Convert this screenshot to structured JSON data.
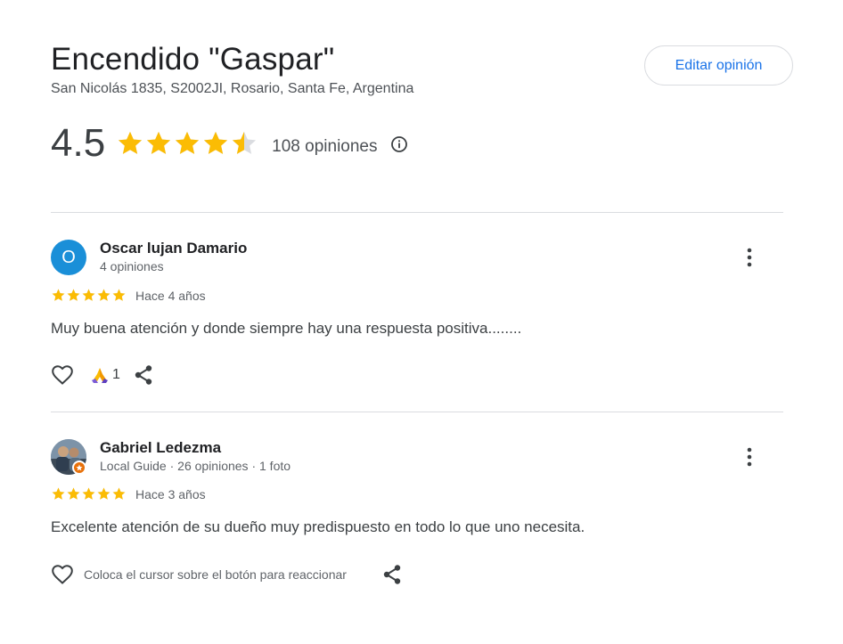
{
  "place": {
    "title": "Encendido \"Gaspar\"",
    "address": "San Nicolás 1835, S2002JI, Rosario, Santa Fe, Argentina",
    "rating": "4.5",
    "rating_value": 4.5,
    "review_count_label": "108 opiniones",
    "edit_button_label": "Editar opinión"
  },
  "colors": {
    "star": "#fbbc04",
    "star_empty": "#dadce0",
    "accent": "#1a73e8",
    "avatar_oscar": "#1a8fd8"
  },
  "icons": {
    "info": "info-circle-icon",
    "more": "more-vert-icon",
    "like": "heart-outline-icon",
    "pray": "pray-reaction-icon",
    "share": "share-icon",
    "local_guide": "local-guide-badge-icon"
  },
  "reviews": [
    {
      "avatar_letter": "O",
      "author": "Oscar lujan Damario",
      "meta": "4 opiniones",
      "stars": 5,
      "date": "Hace 4 años",
      "text": "Muy buena atención y donde siempre hay una respuesta positiva........",
      "reaction_count": "1"
    },
    {
      "author": "Gabriel Ledezma",
      "meta": "Local Guide · 26 opiniones · 1 foto",
      "stars": 5,
      "date": "Hace 3 años",
      "text": "Excelente atención de su dueño muy predispuesto en todo lo que uno necesita.",
      "reaction_hint": "Coloca el cursor sobre el botón para reaccionar"
    }
  ]
}
